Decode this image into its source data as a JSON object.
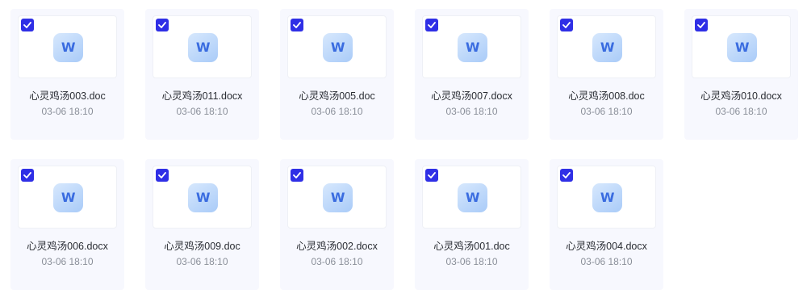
{
  "files": [
    {
      "name": "心灵鸡汤003.doc",
      "date": "03-06 18:10",
      "checked": true,
      "icon": "word-doc-icon",
      "icon_letter": "W"
    },
    {
      "name": "心灵鸡汤011.docx",
      "date": "03-06 18:10",
      "checked": true,
      "icon": "word-doc-icon",
      "icon_letter": "W"
    },
    {
      "name": "心灵鸡汤005.doc",
      "date": "03-06 18:10",
      "checked": true,
      "icon": "word-doc-icon",
      "icon_letter": "W"
    },
    {
      "name": "心灵鸡汤007.docx",
      "date": "03-06 18:10",
      "checked": true,
      "icon": "word-doc-icon",
      "icon_letter": "W"
    },
    {
      "name": "心灵鸡汤008.doc",
      "date": "03-06 18:10",
      "checked": true,
      "icon": "word-doc-icon",
      "icon_letter": "W"
    },
    {
      "name": "心灵鸡汤010.docx",
      "date": "03-06 18:10",
      "checked": true,
      "icon": "word-doc-icon",
      "icon_letter": "W"
    },
    {
      "name": "心灵鸡汤006.docx",
      "date": "03-06 18:10",
      "checked": true,
      "icon": "word-doc-icon",
      "icon_letter": "W"
    },
    {
      "name": "心灵鸡汤009.doc",
      "date": "03-06 18:10",
      "checked": true,
      "icon": "word-doc-icon",
      "icon_letter": "W"
    },
    {
      "name": "心灵鸡汤002.docx",
      "date": "03-06 18:10",
      "checked": true,
      "icon": "word-doc-icon",
      "icon_letter": "W"
    },
    {
      "name": "心灵鸡汤001.doc",
      "date": "03-06 18:10",
      "checked": true,
      "icon": "word-doc-icon",
      "icon_letter": "W"
    },
    {
      "name": "心灵鸡汤004.docx",
      "date": "03-06 18:10",
      "checked": true,
      "icon": "word-doc-icon",
      "icon_letter": "W"
    }
  ],
  "colors": {
    "checkbox": "#2f2fe6",
    "card_bg": "#f7f8fe",
    "word_icon_letter": "#3a6ce0"
  }
}
